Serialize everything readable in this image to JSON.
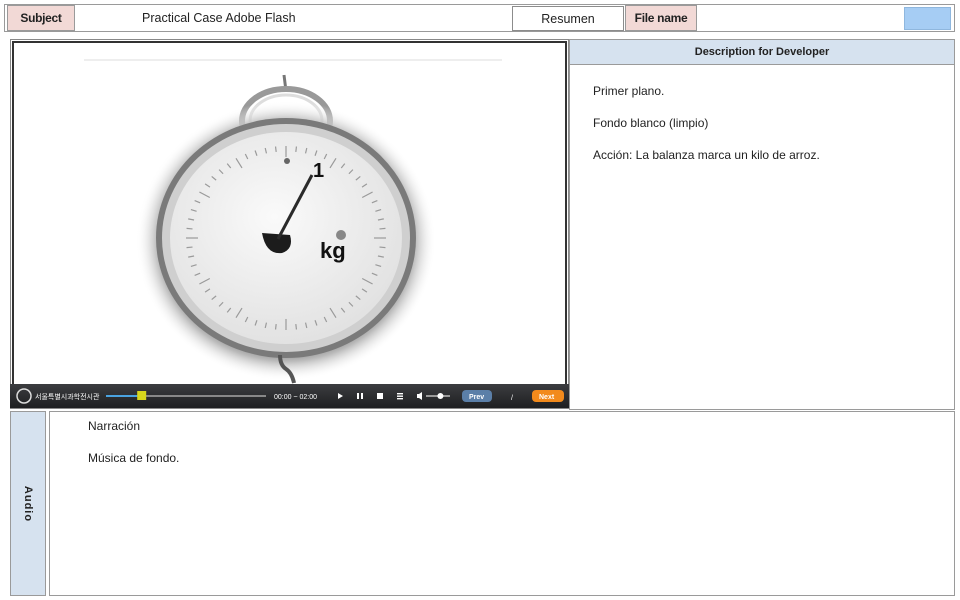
{
  "header": {
    "subject_label": "Subject",
    "subject_value": "Practical Case Adobe Flash",
    "resumen_button": "Resumen",
    "file_name_label": "File name",
    "file_name_value": ""
  },
  "video": {
    "scale_number": "1",
    "scale_unit": "kg",
    "player": {
      "brand": "서울특별시과학전시관",
      "time": "00:00 ~ 02:00",
      "prev_label": "Prev",
      "separator": "/",
      "next_label": "Next",
      "progress": 0.22,
      "volume": 0.6
    }
  },
  "description": {
    "title": "Description for Developer",
    "lines": [
      "Primer plano.",
      "Fondo blanco (limpio)",
      "Acción: La balanza marca un kilo de arroz."
    ]
  },
  "audio": {
    "label": "Audio",
    "lines": [
      "Narración",
      "Música de fondo."
    ]
  },
  "colors": {
    "label_bg": "#f2d9d6",
    "panel_header_bg": "#d6e2ef",
    "accent_blue": "#a6cdf4",
    "next_button": "#f28a1c",
    "prev_button": "#5b7fa8",
    "progress_fill": "#4aa3e0",
    "progress_handle": "#d8d81c"
  }
}
